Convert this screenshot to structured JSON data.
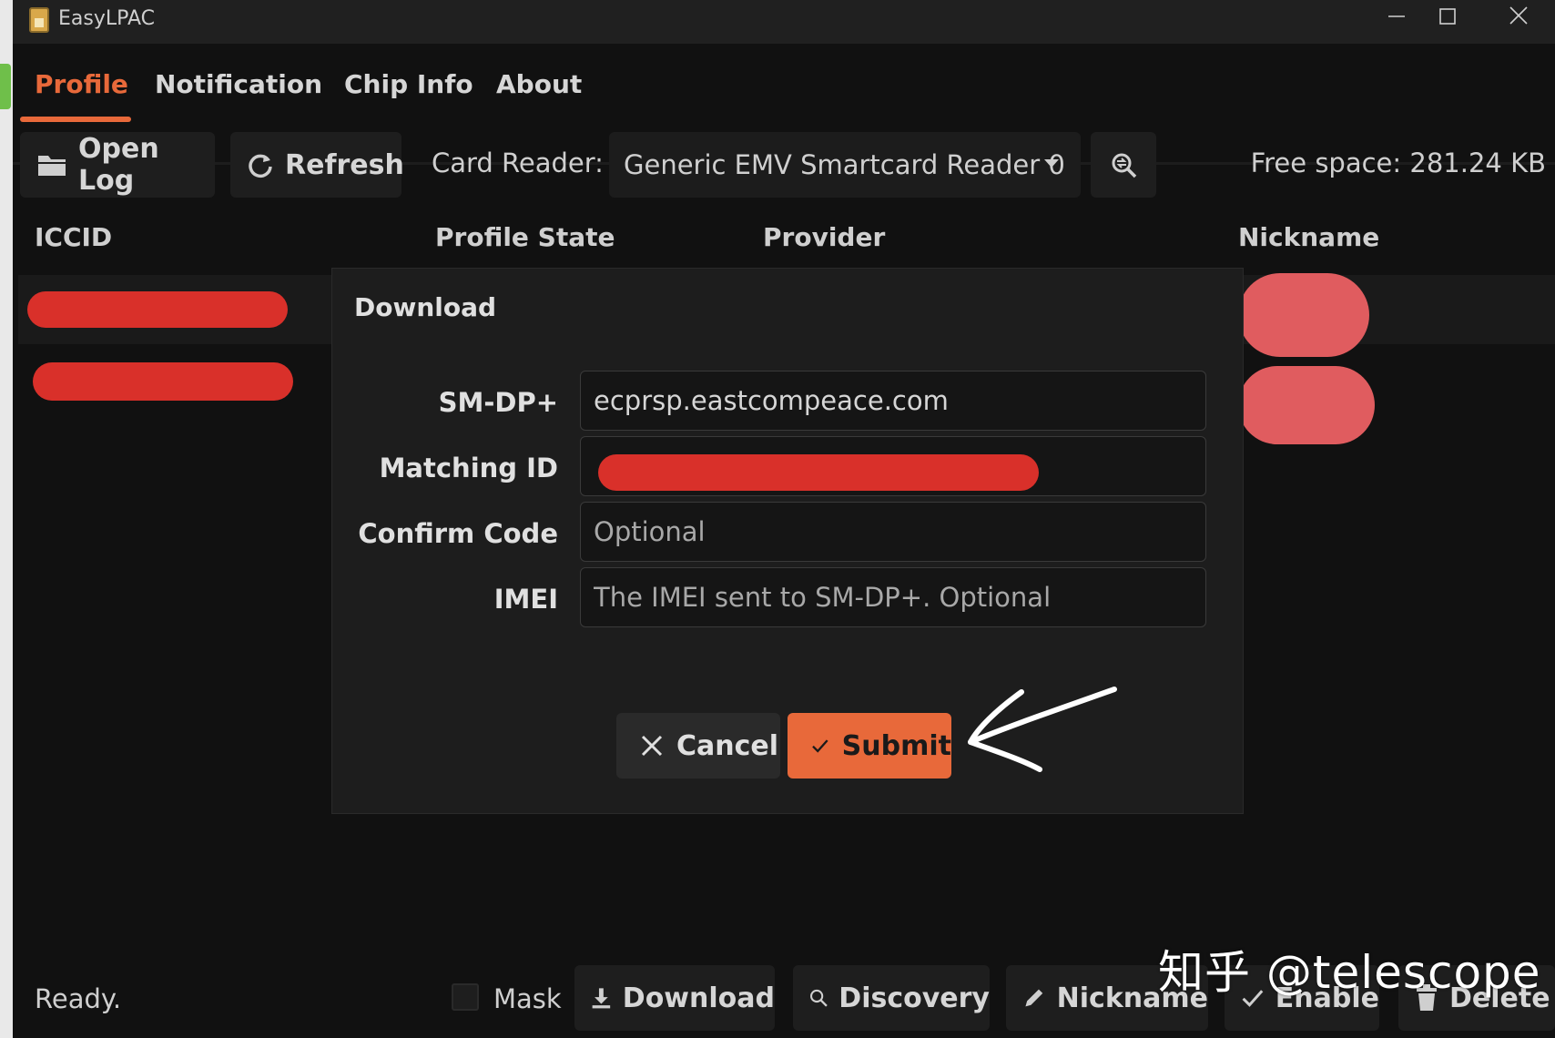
{
  "window": {
    "title": "EasyLPAC"
  },
  "tabs": [
    {
      "label": "Profile",
      "active": true
    },
    {
      "label": "Notification",
      "active": false
    },
    {
      "label": "Chip Info",
      "active": false
    },
    {
      "label": "About",
      "active": false
    }
  ],
  "toolbar": {
    "open_log": "Open Log",
    "refresh": "Refresh",
    "card_reader_label": "Card Reader:",
    "card_reader_value": "Generic EMV Smartcard Reader 0",
    "free_space": "Free space: 281.24 KB"
  },
  "table": {
    "columns": [
      "ICCID",
      "Profile State",
      "Provider",
      "Nickname"
    ]
  },
  "dialog": {
    "title": "Download",
    "fields": {
      "smdp": {
        "label": "SM-DP+",
        "value": "ecprsp.eastcompeace.com"
      },
      "matching_id": {
        "label": "Matching ID",
        "value": ""
      },
      "confirm_code": {
        "label": "Confirm Code",
        "placeholder": "Optional"
      },
      "imei": {
        "label": "IMEI",
        "placeholder": "The IMEI sent to SM-DP+. Optional"
      }
    },
    "cancel": "Cancel",
    "submit": "Submit"
  },
  "statusbar": {
    "status": "Ready.",
    "mask": "Mask",
    "download": "Download",
    "discovery": "Discovery",
    "nickname": "Nickname",
    "enable": "Enable",
    "delete": "Delete"
  },
  "watermark": "知乎 @telescope",
  "colors": {
    "accent": "#e8693a",
    "background": "#111111",
    "redaction": "#d9302a"
  }
}
